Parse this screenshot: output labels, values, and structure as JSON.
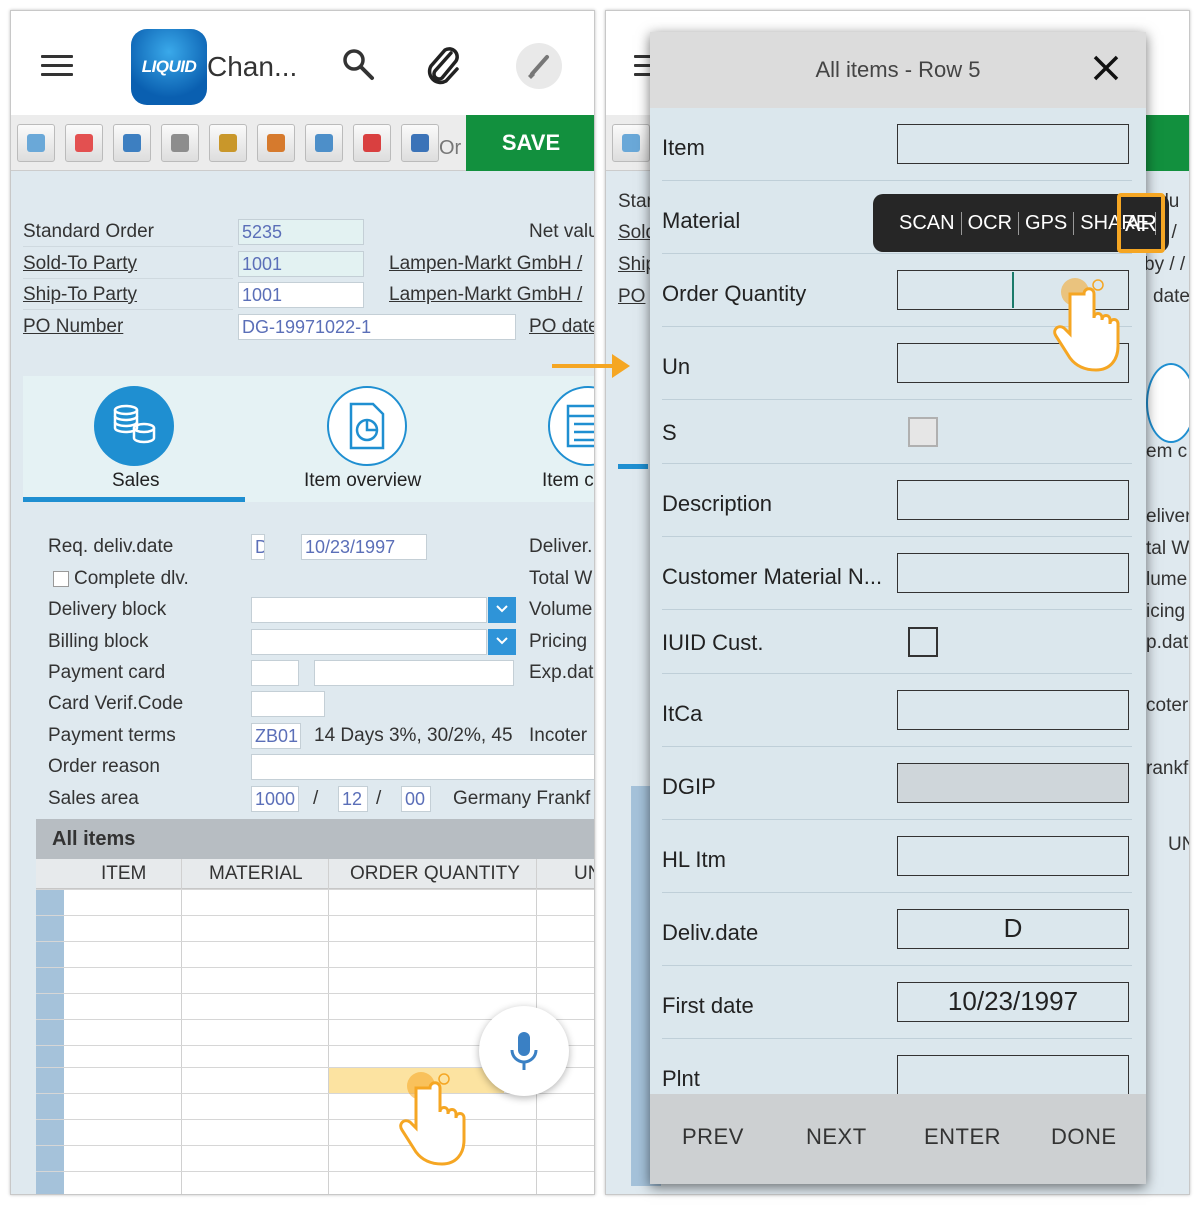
{
  "left": {
    "app_title": "Chan...",
    "logo_text": "LIQUID",
    "toolbar": {
      "order_label": "Or",
      "save_label": "SAVE"
    },
    "header": {
      "standard_order": {
        "label": "Standard Order",
        "value": "5235"
      },
      "sold_to": {
        "label": "Sold-To Party",
        "value": "1001",
        "name": "Lampen-Markt GmbH /"
      },
      "ship_to": {
        "label": "Ship-To Party",
        "value": "1001",
        "name": "Lampen-Markt GmbH /"
      },
      "po_number": {
        "label": "PO Number",
        "value": "DG-19971022-1"
      },
      "net_value_label": "Net valu",
      "po_date_label": "PO date"
    },
    "tabs": [
      {
        "label": "Sales"
      },
      {
        "label": "Item overview"
      },
      {
        "label": "Item c"
      }
    ],
    "sales": {
      "req_deliv": {
        "label": "Req. deliv.date",
        "unit": "D",
        "value": "10/23/1997"
      },
      "complete_dlv": "Complete dlv.",
      "delivery_block": "Delivery block",
      "billing_block": "Billing block",
      "payment_card": "Payment card",
      "card_verif": "Card Verif.Code",
      "payment_terms": {
        "label": "Payment terms",
        "value": "ZB01",
        "text": "14 Days 3%, 30/2%, 45"
      },
      "order_reason": "Order reason",
      "sales_area": {
        "label": "Sales area",
        "org": "1000",
        "dist": "12",
        "div": "00",
        "sep": "/",
        "text": "Germany Frankf"
      },
      "right_labels": [
        "Deliver.",
        "Total W",
        "Volume",
        "Pricing",
        "Exp.dat",
        "Incoter"
      ]
    },
    "items": {
      "title": "All items",
      "columns": [
        "ITEM",
        "MATERIAL",
        "ORDER QUANTITY",
        "UN"
      ]
    }
  },
  "right": {
    "bg_labels": {
      "stan": "Stan",
      "sold": "Sold",
      "ship": "Ship",
      "po": "PO",
      "valu": "alu",
      "slash": "/ /",
      "by": "by / /",
      "date": "date",
      "em_c": "em c",
      "deliver": "eliver.",
      "tal_w": "tal W",
      "lume": "lume",
      "icing": "icing",
      "p_dat": "p.dat",
      "coter": "coter",
      "rankf": "rankf",
      "un": "UN"
    },
    "modal": {
      "title": "All items - Row 5",
      "fields": [
        {
          "label": "Item",
          "value": ""
        },
        {
          "label": "Material",
          "value": ""
        },
        {
          "label": "Order Quantity",
          "value": ""
        },
        {
          "label": "Un",
          "value": ""
        },
        {
          "label": "S",
          "value": ""
        },
        {
          "label": "Description",
          "value": ""
        },
        {
          "label": "Customer Material N...",
          "value": ""
        },
        {
          "label": "IUID Cust.",
          "value": ""
        },
        {
          "label": "ItCa",
          "value": ""
        },
        {
          "label": "DGIP",
          "value": ""
        },
        {
          "label": "HL Itm",
          "value": ""
        },
        {
          "label": "Deliv.date",
          "value": "D"
        },
        {
          "label": "First date",
          "value": "10/23/1997"
        },
        {
          "label": "Plnt",
          "value": ""
        }
      ],
      "context_menu": [
        "SCAN",
        "OCR",
        "GPS",
        "SHARE",
        "AR"
      ],
      "footer": [
        "PREV",
        "NEXT",
        "ENTER",
        "DONE"
      ]
    }
  },
  "colors": {
    "accent": "#1f8fd1",
    "save": "#12903e",
    "highlight": "#f5a623"
  }
}
